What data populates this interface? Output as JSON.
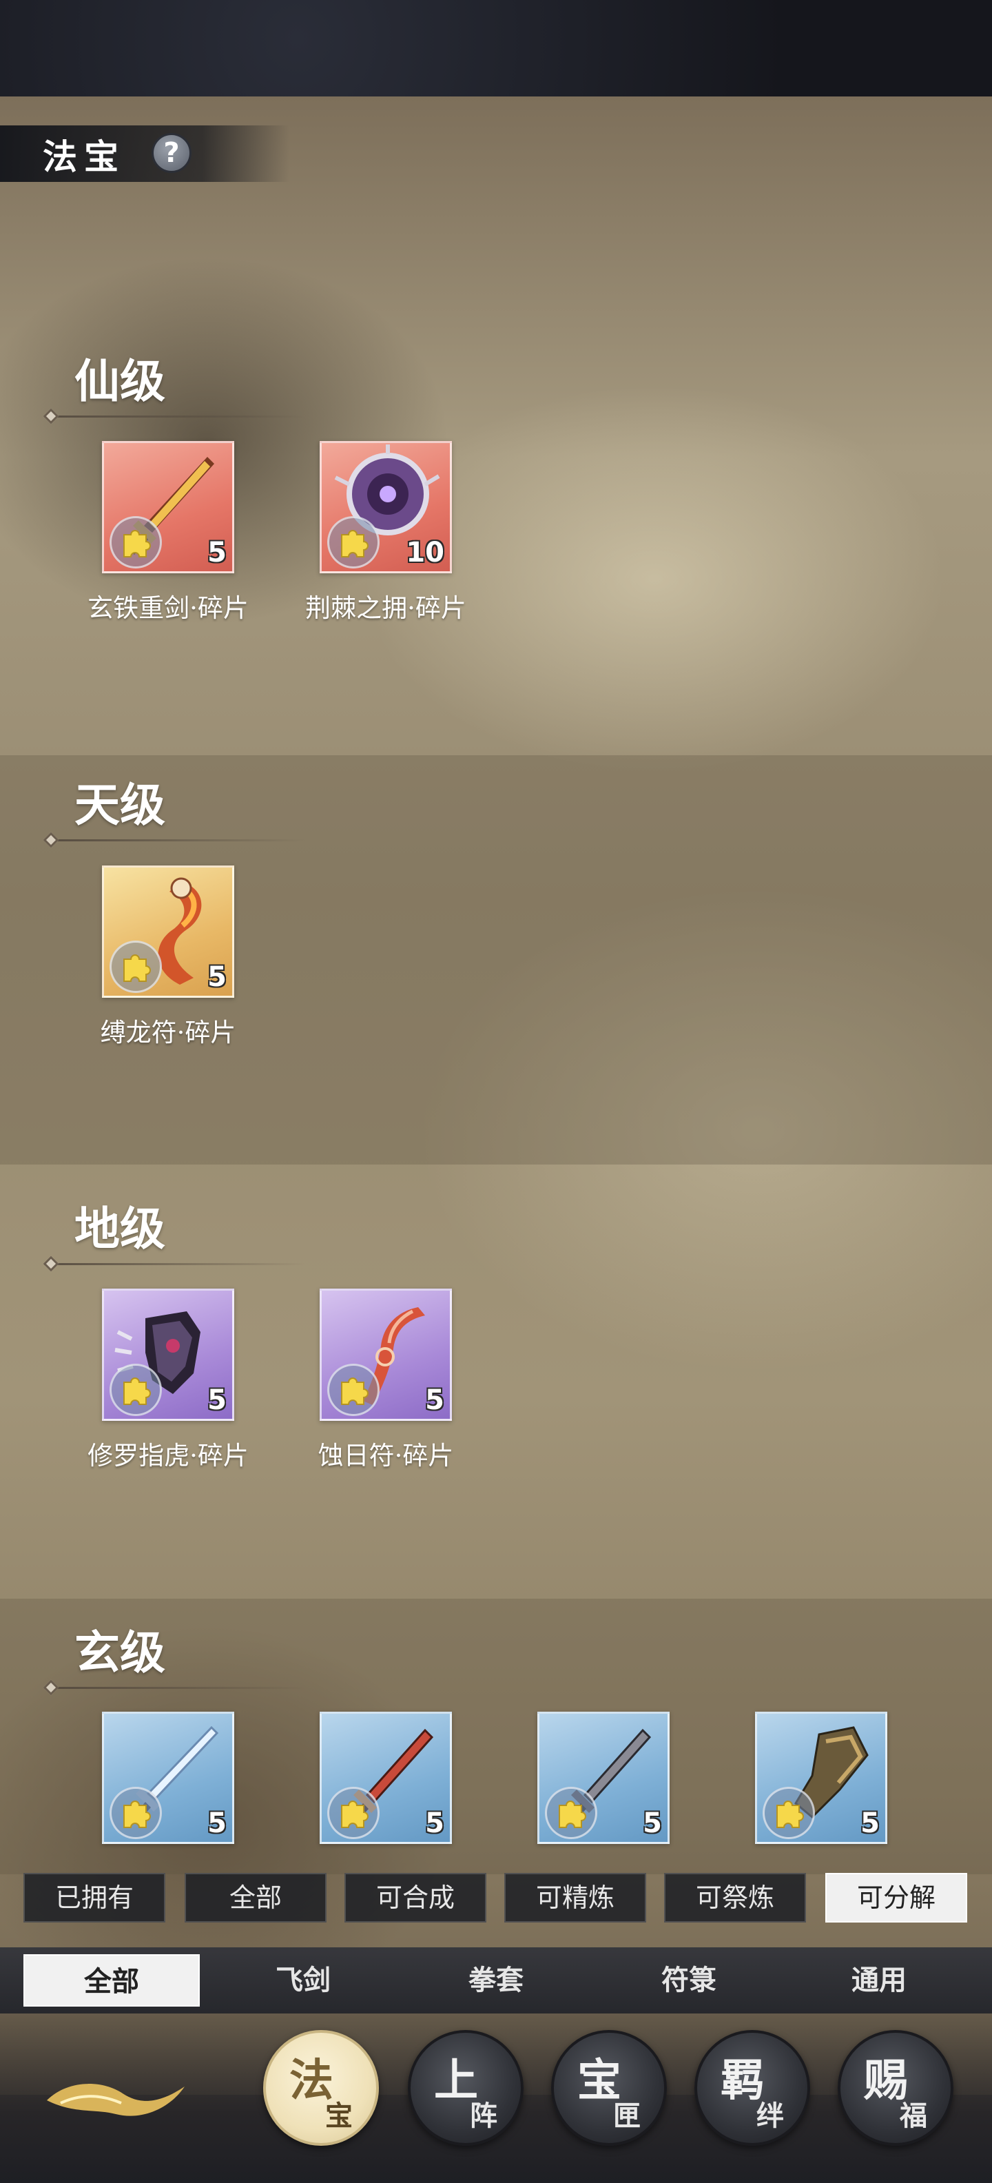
{
  "header": {
    "title": "法宝",
    "help_icon": "question-mark-icon"
  },
  "tiers": [
    {
      "name": "仙级",
      "items": [
        {
          "label": "玄铁重剑·碎片",
          "count": "5",
          "rarity_color": "red"
        },
        {
          "label": "荆棘之拥·碎片",
          "count": "10",
          "rarity_color": "red"
        }
      ]
    },
    {
      "name": "天级",
      "items": [
        {
          "label": "缚龙符·碎片",
          "count": "5",
          "rarity_color": "gold"
        }
      ]
    },
    {
      "name": "地级",
      "items": [
        {
          "label": "修罗指虎·碎片",
          "count": "5",
          "rarity_color": "purple"
        },
        {
          "label": "蚀日符·碎片",
          "count": "5",
          "rarity_color": "purple"
        }
      ]
    },
    {
      "name": "玄级",
      "items": [
        {
          "label": "",
          "count": "5",
          "rarity_color": "blue"
        },
        {
          "label": "",
          "count": "5",
          "rarity_color": "blue"
        },
        {
          "label": "",
          "count": "5",
          "rarity_color": "blue"
        },
        {
          "label": "",
          "count": "5",
          "rarity_color": "blue"
        }
      ]
    }
  ],
  "filters": [
    "已拥有",
    "全部",
    "可合成",
    "可精炼",
    "可祭炼",
    "可分解"
  ],
  "active_filter": "可分解",
  "categories": [
    "全部",
    "飞剑",
    "拳套",
    "符箓",
    "通用"
  ],
  "active_category": "全部",
  "nav": [
    {
      "big": "法",
      "small": "宝",
      "active": true
    },
    {
      "big": "上",
      "small": "阵",
      "active": false
    },
    {
      "big": "宝",
      "small": "匣",
      "active": false
    },
    {
      "big": "羁",
      "small": "绊",
      "active": false
    },
    {
      "big": "赐",
      "small": "福",
      "active": false
    }
  ],
  "colors": {
    "red": "#e57667",
    "gold": "#e8b866",
    "purple": "#a98ad8",
    "blue": "#7fb0d6",
    "active_filter_bg": "#f0f0f0"
  }
}
